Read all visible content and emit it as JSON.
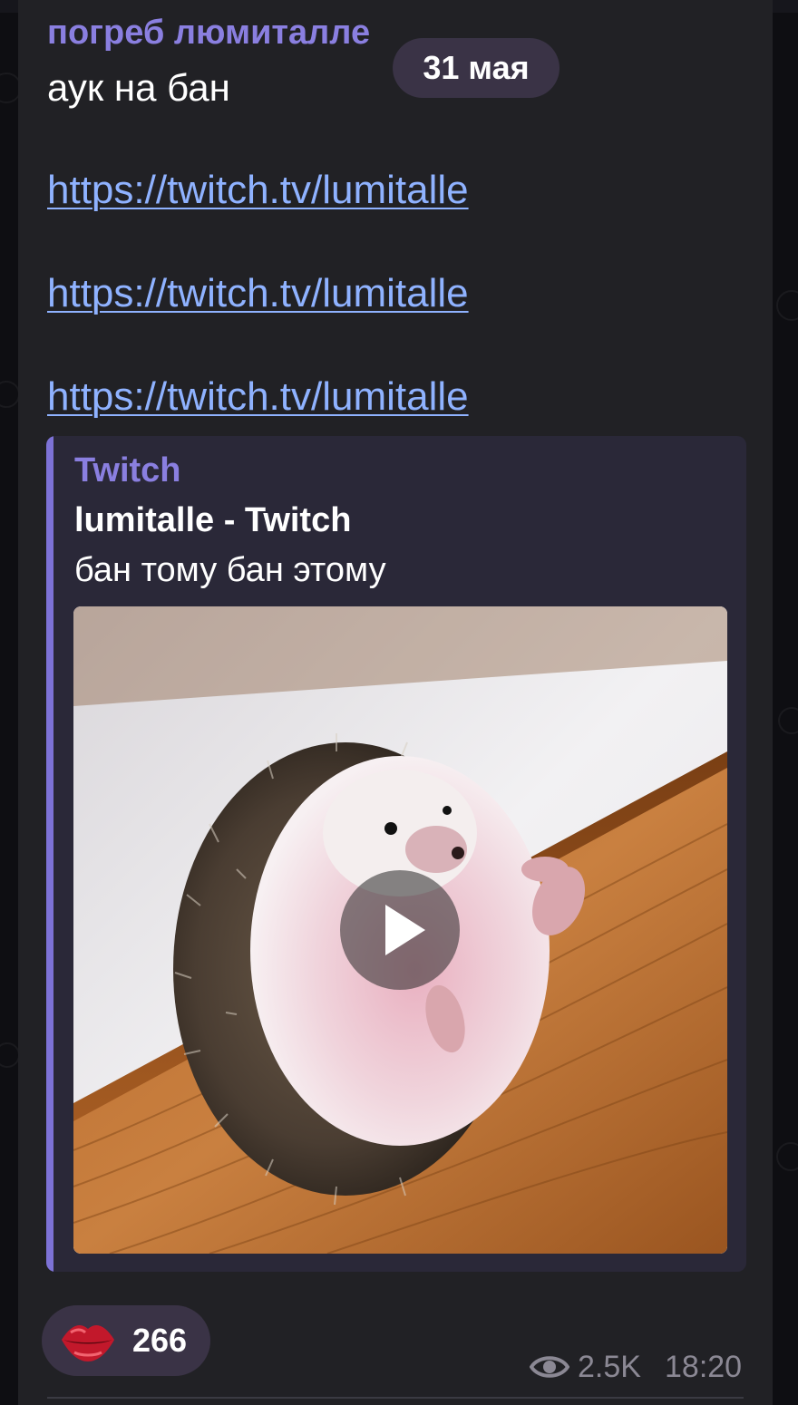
{
  "message": {
    "sender": "погреб люмиталле",
    "date_badge": "31 мая",
    "text": "аук на бан",
    "links": [
      "https://twitch.tv/lumitalle",
      "https://twitch.tv/lumitalle",
      "https://twitch.tv/lumitalle"
    ],
    "link_preview": {
      "site": "Twitch",
      "title": "lumitalle - Twitch",
      "description": "бан тому бан этому",
      "image_subject": "hedgehog-photo",
      "play_icon": "play-icon"
    },
    "reaction": {
      "icon": "lips-icon",
      "count": "266"
    },
    "views": "2.5K",
    "views_icon": "eye-icon",
    "time": "18:20"
  },
  "colors": {
    "bubble": "#212125",
    "accent": "#8a7fe0",
    "link": "#8fb2ff",
    "preview_bg": "#2a2838",
    "pill": "#3a3346",
    "meta": "#8b8894"
  }
}
